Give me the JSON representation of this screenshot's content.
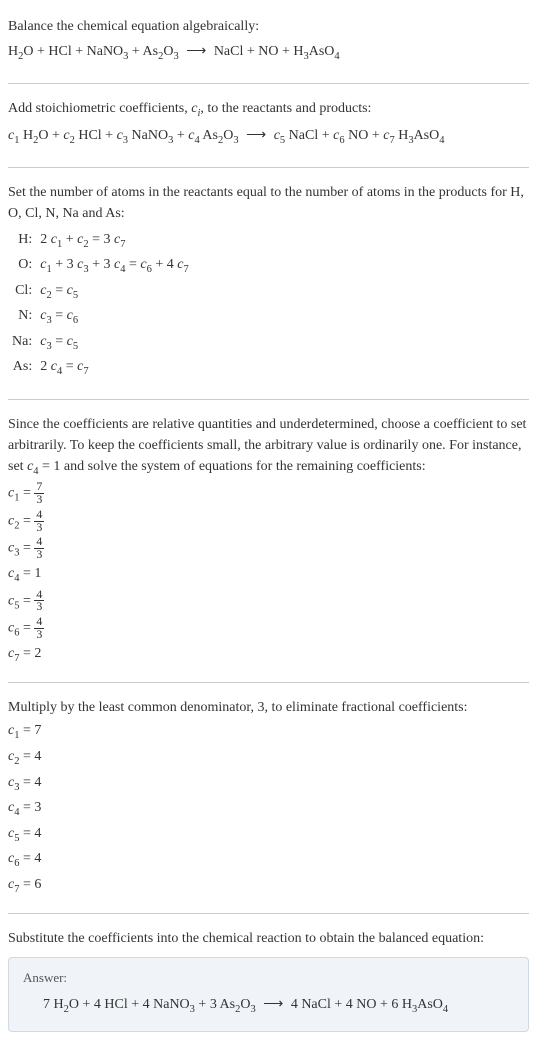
{
  "intro": {
    "line1": "Balance the chemical equation algebraically:",
    "eq_lhs": "H₂O + HCl + NaNO₃ + As₂O₃",
    "eq_rhs": "NaCl + NO + H₃AsO₄"
  },
  "stoich": {
    "text": "Add stoichiometric coefficients, ",
    "ci": "c",
    "ci_sub": "i",
    "text2": ", to the reactants and products:",
    "eq_lhs_parts": [
      "c₁ H₂O + c₂ HCl + c₃ NaNO₃ + c₄ As₂O₃"
    ],
    "eq_rhs_parts": [
      "c₅ NaCl + c₆ NO + c₇ H₃AsO₄"
    ]
  },
  "atoms": {
    "text": "Set the number of atoms in the reactants equal to the number of atoms in the products for H, O, Cl, N, Na and As:",
    "rows": [
      {
        "elem": "H:",
        "eq": "2 c₁ + c₂ = 3 c₇"
      },
      {
        "elem": "O:",
        "eq": "c₁ + 3 c₃ + 3 c₄ = c₆ + 4 c₇"
      },
      {
        "elem": "Cl:",
        "eq": "c₂ = c₅"
      },
      {
        "elem": "N:",
        "eq": "c₃ = c₆"
      },
      {
        "elem": "Na:",
        "eq": "c₃ = c₅"
      },
      {
        "elem": "As:",
        "eq": "2 c₄ = c₇"
      }
    ]
  },
  "underdet": {
    "text": "Since the coefficients are relative quantities and underdetermined, choose a coefficient to set arbitrarily. To keep the coefficients small, the arbitrary value is ordinarily one. For instance, set c₄ = 1 and solve the system of equations for the remaining coefficients:",
    "coefs": [
      {
        "lhs": "c₁ =",
        "num": "7",
        "den": "3"
      },
      {
        "lhs": "c₂ =",
        "num": "4",
        "den": "3"
      },
      {
        "lhs": "c₃ =",
        "num": "4",
        "den": "3"
      },
      {
        "lhs": "c₄ =",
        "val": "1"
      },
      {
        "lhs": "c₅ =",
        "num": "4",
        "den": "3"
      },
      {
        "lhs": "c₆ =",
        "num": "4",
        "den": "3"
      },
      {
        "lhs": "c₇ =",
        "val": "2"
      }
    ]
  },
  "multiply": {
    "text": "Multiply by the least common denominator, 3, to eliminate fractional coefficients:",
    "coefs": [
      {
        "lhs": "c₁ =",
        "val": "7"
      },
      {
        "lhs": "c₂ =",
        "val": "4"
      },
      {
        "lhs": "c₃ =",
        "val": "4"
      },
      {
        "lhs": "c₄ =",
        "val": "3"
      },
      {
        "lhs": "c₅ =",
        "val": "4"
      },
      {
        "lhs": "c₆ =",
        "val": "4"
      },
      {
        "lhs": "c₇ =",
        "val": "6"
      }
    ]
  },
  "substitute": {
    "text": "Substitute the coefficients into the chemical reaction to obtain the balanced equation:"
  },
  "answer": {
    "label": "Answer:",
    "eq_lhs": "7 H₂O + 4 HCl + 4 NaNO₃ + 3 As₂O₃",
    "eq_rhs": "4 NaCl + 4 NO + 6 H₃AsO₄"
  }
}
